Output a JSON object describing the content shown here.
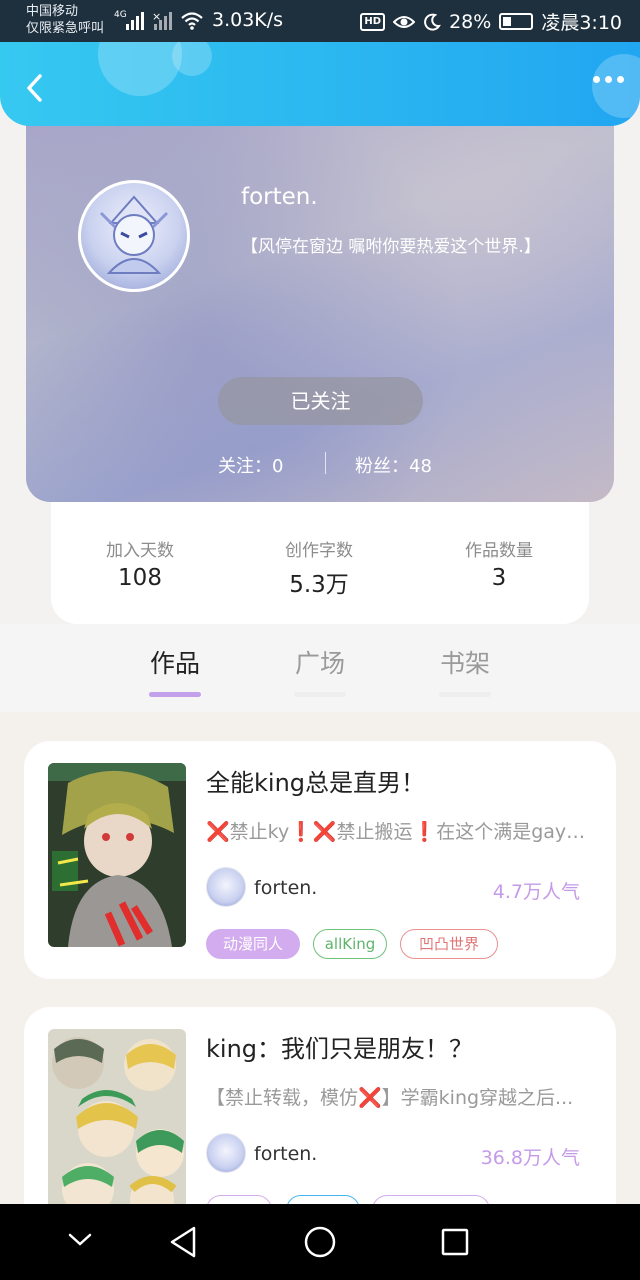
{
  "status_bar": {
    "carrier_line1": "中国移动",
    "carrier_line2": "仅限紧急呼叫",
    "network": "4G",
    "speed": "3.03K/s",
    "hd": "HD",
    "battery": "28%",
    "time": "凌晨3:10"
  },
  "header": {
    "back_icon": "chevron-left-icon",
    "more_icon": "more-dots-icon"
  },
  "profile": {
    "username": "forten.",
    "bio": "【风停在窗边 嘱咐你要热爱这个世界.】",
    "follow_button": "已关注",
    "following_label": "关注：0",
    "followers_label": "粉丝：48"
  },
  "stats": [
    {
      "label": "加入天数",
      "value": "108"
    },
    {
      "label": "创作字数",
      "value": "5.3万"
    },
    {
      "label": "作品数量",
      "value": "3"
    }
  ],
  "tabs": [
    {
      "label": "作品",
      "active": true
    },
    {
      "label": "广场",
      "active": false
    },
    {
      "label": "书架",
      "active": false
    }
  ],
  "works": [
    {
      "title": "全能king总是直男！",
      "description": "❌禁止ky❗️❌禁止搬运❗️在这个满是gay的世界",
      "author": "forten.",
      "popularity": "4.7万人气",
      "tags": [
        "动漫同人",
        "allKing",
        "凹凸世界"
      ]
    },
    {
      "title": "king：我们只是朋友！？",
      "description": "【禁止转载，模仿❌】学霸king穿越之后...",
      "author": "forten.",
      "popularity": "36.8万人气",
      "tags": [
        "",
        "",
        ""
      ]
    }
  ],
  "colors": {
    "accent": "#c3a0ec",
    "header_blue": "#21a6f1",
    "popularity": "#c59be8"
  }
}
